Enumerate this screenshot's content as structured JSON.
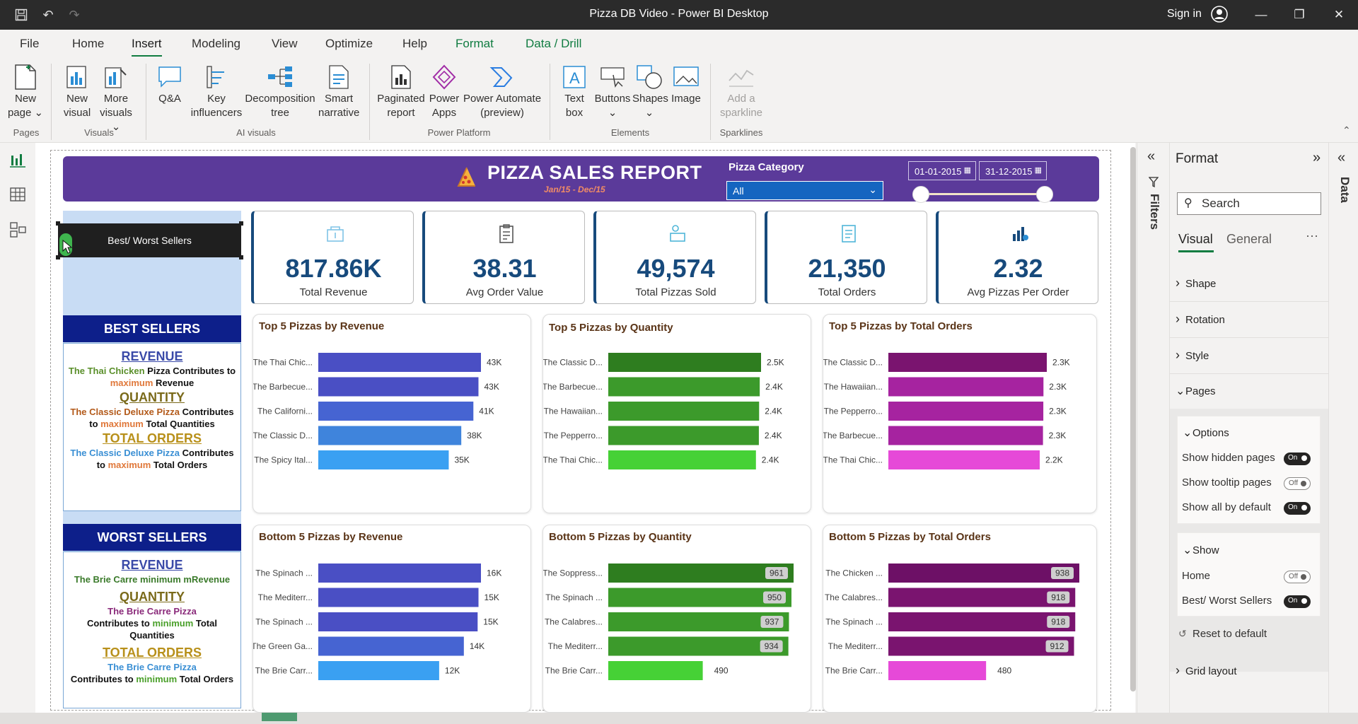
{
  "window": {
    "title": "Pizza DB Video - Power BI Desktop",
    "sign_in": "Sign in"
  },
  "menu": {
    "items": [
      "File",
      "Home",
      "Insert",
      "Modeling",
      "View",
      "Optimize",
      "Help",
      "Format",
      "Data / Drill"
    ],
    "active": "Insert"
  },
  "ribbon": {
    "buttons": {
      "new_page": "New page",
      "new_visual": "New visual",
      "more_visuals": "More visuals",
      "qa": "Q&A",
      "key_influencers": "Key influencers",
      "decomposition_tree": "Decomposition tree",
      "smart_narrative": "Smart narrative",
      "paginated_report": "Paginated report",
      "power_apps": "Power Apps",
      "power_automate": "Power Automate (preview)",
      "text_box": "Text box",
      "buttons": "Buttons",
      "shapes": "Shapes",
      "image": "Image",
      "add_sparkline": "Add a sparkline"
    },
    "groups": {
      "pages": "Pages",
      "visuals": "Visuals",
      "ai_visuals": "AI visuals",
      "power_platform": "Power Platform",
      "elements": "Elements",
      "sparklines": "Sparklines"
    }
  },
  "report": {
    "title": "PIZZA SALES REPORT",
    "subtitle": "Jan/15 - Dec/15",
    "category_label": "Pizza Category",
    "category_value": "All",
    "date_from": "01-01-2015",
    "date_to": "31-12-2015",
    "nav_button": "Best/ Worst Sellers"
  },
  "kpis": [
    {
      "value": "817.86K",
      "label": "Total Revenue"
    },
    {
      "value": "38.31",
      "label": "Avg Order Value"
    },
    {
      "value": "49,574",
      "label": "Total Pizzas Sold"
    },
    {
      "value": "21,350",
      "label": "Total Orders"
    },
    {
      "value": "2.32",
      "label": "Avg Pizzas Per Order"
    }
  ],
  "best": {
    "heading": "BEST SELLERS",
    "revenue_h": "REVENUE",
    "revenue_name": "The Thai Chicken",
    "revenue_mid": " Pizza Contributes to",
    "revenue_max": "maximum",
    "revenue_end": " Revenue",
    "quantity_h": "QUANTITY",
    "quantity_name": "The Classic Deluxe Pizza",
    "quantity_mid": " Contributes",
    "quantity_to": "to ",
    "quantity_max": "maximum",
    "quantity_end": " Total Quantities",
    "orders_h": "TOTAL ORDERS",
    "orders_name": "The Classic Deluxe Pizza",
    "orders_mid": " Contributes",
    "orders_to": "to ",
    "orders_max": "maximum",
    "orders_end": " Total Orders"
  },
  "worst": {
    "heading": "WORST SELLERS",
    "revenue_h": "REVENUE",
    "revenue_text": "The Brie Carre minimum mRevenue",
    "quantity_h": "QUANTITY",
    "quantity_name": "The Brie Carre Pizza",
    "quantity_pre": "Contributes to ",
    "quantity_min": "minimum",
    "quantity_end": " Total",
    "quantity_end2": "Quantities",
    "orders_h": "TOTAL ORDERS",
    "orders_name": "The Brie Carre Pizza",
    "orders_pre": "Contributes to ",
    "orders_min": "minimum",
    "orders_end": " Total Orders"
  },
  "chart_data": [
    {
      "type": "bar",
      "title": "Top 5 Pizzas by Revenue",
      "categories": [
        "The Thai Chic...",
        "The Barbecue...",
        "The Californi...",
        "The Classic D...",
        "The Spicy Ital..."
      ],
      "values": [
        43434,
        42768,
        41410,
        38180,
        34831
      ],
      "labels": [
        "43K",
        "43K",
        "41K",
        "38K",
        "35K"
      ],
      "colors": [
        "#4a4fc4",
        "#4a4fc4",
        "#4664d2",
        "#3f84dc",
        "#3aa0f2"
      ],
      "labels_inside": false
    },
    {
      "type": "bar",
      "title": "Top 5 Pizzas by Quantity",
      "categories": [
        "The Classic D...",
        "The Barbecue...",
        "The Hawaiian...",
        "The Pepperro...",
        "The Thai Chic..."
      ],
      "values": [
        2453,
        2432,
        2422,
        2418,
        2371
      ],
      "labels": [
        "2.5K",
        "2.4K",
        "2.4K",
        "2.4K",
        "2.4K"
      ],
      "colors": [
        "#2e7d1f",
        "#3c9a2b",
        "#3c9a2b",
        "#3c9a2b",
        "#46d136"
      ],
      "labels_inside": false
    },
    {
      "type": "bar",
      "title": "Top 5 Pizzas by Total Orders",
      "categories": [
        "The Classic D...",
        "The Hawaiian...",
        "The Pepperro...",
        "The Barbecue...",
        "The Thai Chic..."
      ],
      "values": [
        2329,
        2280,
        2278,
        2273,
        2225
      ],
      "labels": [
        "2.3K",
        "2.3K",
        "2.3K",
        "2.3K",
        "2.2K"
      ],
      "colors": [
        "#7a146f",
        "#a623a0",
        "#a623a0",
        "#a623a0",
        "#e649d8"
      ],
      "labels_inside": false
    },
    {
      "type": "bar",
      "title": "Bottom 5 Pizzas by Revenue",
      "categories": [
        "The Spinach ...",
        "The Mediterr...",
        "The Spinach ...",
        "The Green Ga...",
        "The Brie Carr..."
      ],
      "values": [
        15596,
        15360,
        15277,
        13956,
        11588
      ],
      "labels": [
        "16K",
        "15K",
        "15K",
        "14K",
        "12K"
      ],
      "colors": [
        "#4a4fc4",
        "#4a4fc4",
        "#4a4fc4",
        "#4664d2",
        "#3aa0f2"
      ],
      "labels_inside": false
    },
    {
      "type": "bar",
      "title": "Bottom 5 Pizzas by Quantity",
      "categories": [
        "The Soppress...",
        "The Spinach ...",
        "The Calabres...",
        "The Mediterr...",
        "The Brie Carr..."
      ],
      "values": [
        961,
        950,
        937,
        934,
        490
      ],
      "labels": [
        "961",
        "950",
        "937",
        "934",
        "490"
      ],
      "colors": [
        "#2e7d1f",
        "#3c9a2b",
        "#3c9a2b",
        "#3c9a2b",
        "#46d136"
      ],
      "labels_inside": true
    },
    {
      "type": "bar",
      "title": "Bottom 5 Pizzas by Total Orders",
      "categories": [
        "The Chicken ...",
        "The Calabres...",
        "The Spinach ...",
        "The Mediterr...",
        "The Brie Carr..."
      ],
      "values": [
        938,
        918,
        918,
        912,
        480
      ],
      "labels": [
        "938",
        "918",
        "918",
        "912",
        "480"
      ],
      "colors": [
        "#6d1066",
        "#7a146f",
        "#7a146f",
        "#7a146f",
        "#e649d8"
      ],
      "labels_inside": true
    }
  ],
  "filters": {
    "label": "Filters"
  },
  "format_pane": {
    "title": "Format",
    "search_placeholder": "Search",
    "tabs": [
      "Visual",
      "General"
    ],
    "sections": {
      "shape": "Shape",
      "rotation": "Rotation",
      "style": "Style",
      "pages": "Pages",
      "grid_layout": "Grid layout"
    },
    "options_title": "Options",
    "show_hidden": "Show hidden pages",
    "show_tooltip": "Show tooltip pages",
    "show_all": "Show all by default",
    "show_title": "Show",
    "home": "Home",
    "best_worst": "Best/ Worst Sellers",
    "reset": "Reset to default",
    "on": "On",
    "off": "Off"
  },
  "data_pane": {
    "label": "Data"
  }
}
